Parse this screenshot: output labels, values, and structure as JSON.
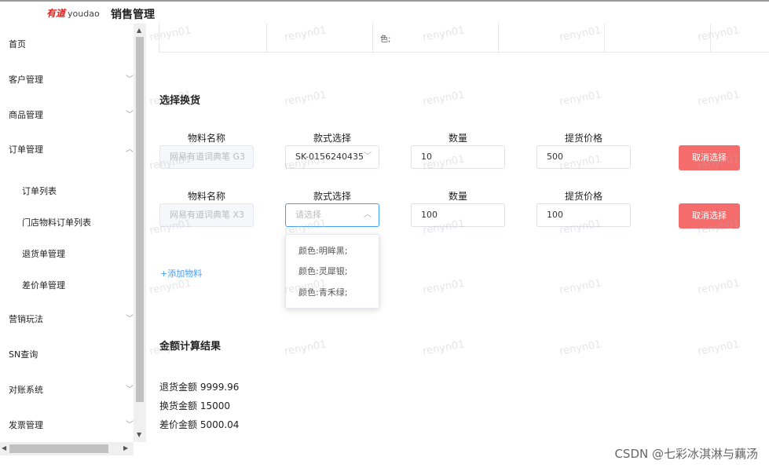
{
  "header": {
    "logo_brand": "有道",
    "logo_text": "youdao",
    "app_title": "销售管理"
  },
  "sidebar": {
    "menu": [
      {
        "label": "首页",
        "has_chevron": false
      },
      {
        "label": "客户管理",
        "has_chevron": true
      },
      {
        "label": "商品管理",
        "has_chevron": true
      },
      {
        "label": "订单管理",
        "has_chevron": true,
        "expanded": true
      },
      {
        "label": "营销玩法",
        "has_chevron": true
      },
      {
        "label": "SN查询",
        "has_chevron": false
      },
      {
        "label": "对账系统",
        "has_chevron": true
      },
      {
        "label": "发票管理",
        "has_chevron": true
      }
    ],
    "order_submenu": [
      "订单列表",
      "门店物料订单列表",
      "退货单管理",
      "差价单管理"
    ]
  },
  "table_top": {
    "cell_text": "色;"
  },
  "exchange": {
    "title": "选择换货",
    "labels": {
      "material": "物料名称",
      "style": "款式选择",
      "quantity": "数量",
      "price": "提货价格"
    },
    "rows": [
      {
        "material": "网易有道词典笔 G3",
        "style": "SK-0156240435",
        "style_placeholder": "",
        "quantity": "10",
        "price": "500",
        "cancel": "取消选择"
      },
      {
        "material": "网易有道词典笔 X3",
        "style": "",
        "style_placeholder": "请选择",
        "quantity": "100",
        "price": "100",
        "cancel": "取消选择"
      }
    ],
    "dropdown_options": [
      "颜色:明眸黑;",
      "颜色:灵犀银;",
      "颜色:青禾绿;"
    ],
    "add_label": "+添加物料"
  },
  "result": {
    "title": "金额计算结果",
    "return_amount": "退货金额 9999.96",
    "exchange_amount": "换货金额 15000",
    "diff_amount": "差价金额 5000.04"
  },
  "watermark": "renyn01",
  "footer_credit": "CSDN @七彩冰淇淋与藕汤",
  "colors": {
    "accent": "#409eff",
    "danger": "#f56c6c",
    "brand_red": "#e02020"
  }
}
